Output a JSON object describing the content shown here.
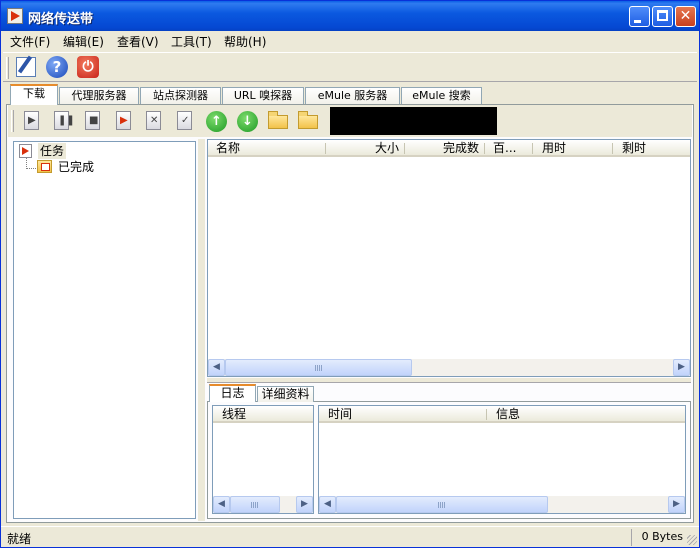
{
  "window": {
    "title": "网络传送带"
  },
  "menu": {
    "file": "文件(F)",
    "edit": "编辑(E)",
    "view": "查看(V)",
    "tools": "工具(T)",
    "help": "帮助(H)"
  },
  "main_toolbar": {
    "icons": [
      "edit-options-icon",
      "help-icon",
      "power-exit-icon"
    ]
  },
  "tabs": [
    {
      "label": "下载"
    },
    {
      "label": "代理服务器"
    },
    {
      "label": "站点探测器"
    },
    {
      "label": "URL 嗅探器"
    },
    {
      "label": "eMule 服务器"
    },
    {
      "label": "eMule 搜索"
    }
  ],
  "download_toolbar": {
    "icons": [
      "start-task-icon",
      "pause-task-icon",
      "stop-task-icon",
      "new-task-icon",
      "delete-task-icon",
      "task-properties-icon",
      "move-up-icon",
      "move-down-icon",
      "open-file-icon",
      "open-folder-icon"
    ]
  },
  "tree": {
    "root": "任务",
    "children": [
      "已完成"
    ]
  },
  "task_list": {
    "columns": [
      "名称",
      "大小",
      "完成数",
      "百...",
      "用时",
      "剩时"
    ]
  },
  "log": {
    "tabs": [
      "日志",
      "详细资料"
    ],
    "thread_header": "线程",
    "columns": [
      "时间",
      "信息"
    ]
  },
  "status": {
    "text": "就绪",
    "bytes": "0 Bytes"
  },
  "colors": {
    "titlebar": "#0548D2",
    "accent_tab": "#E68B2C",
    "face": "#ECE9D8"
  }
}
